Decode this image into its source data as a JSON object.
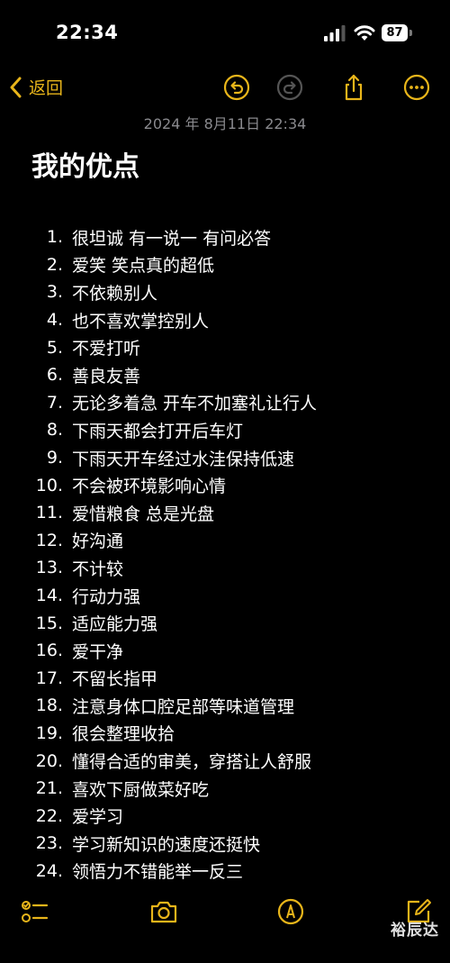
{
  "status_bar": {
    "time": "22:34",
    "battery": "87"
  },
  "nav": {
    "back_label": "返回"
  },
  "note": {
    "date": "2024 年 8月11日 22:34",
    "title": "我的优点",
    "items": [
      {
        "num": "1.",
        "text": "很坦诚 有一说一 有问必答"
      },
      {
        "num": "2.",
        "text": "爱笑 笑点真的超低"
      },
      {
        "num": "3.",
        "text": "不依赖别人"
      },
      {
        "num": "4.",
        "text": "也不喜欢掌控别人"
      },
      {
        "num": "5.",
        "text": "不爱打听"
      },
      {
        "num": "6.",
        "text": "善良友善"
      },
      {
        "num": "7.",
        "text": "无论多着急 开车不加塞礼让行人"
      },
      {
        "num": "8.",
        "text": "下雨天都会打开后车灯"
      },
      {
        "num": "9.",
        "text": "下雨天开车经过水洼保持低速"
      },
      {
        "num": "10.",
        "text": "不会被环境影响心情"
      },
      {
        "num": "11.",
        "text": "爱惜粮食 总是光盘"
      },
      {
        "num": "12.",
        "text": "好沟通"
      },
      {
        "num": "13.",
        "text": "不计较"
      },
      {
        "num": "14.",
        "text": "行动力强"
      },
      {
        "num": "15.",
        "text": "适应能力强"
      },
      {
        "num": "16.",
        "text": "爱干净"
      },
      {
        "num": "17.",
        "text": "不留长指甲"
      },
      {
        "num": "18.",
        "text": "注意身体口腔足部等味道管理"
      },
      {
        "num": "19.",
        "text": "很会整理收拾"
      },
      {
        "num": "20.",
        "text": "懂得合适的审美，穿搭让人舒服"
      },
      {
        "num": "21.",
        "text": "喜欢下厨做菜好吃"
      },
      {
        "num": "22.",
        "text": "爱学习"
      },
      {
        "num": "23.",
        "text": "学习新知识的速度还挺快"
      },
      {
        "num": "24.",
        "text": "领悟力不错能举一反三"
      }
    ]
  },
  "watermark": "裕辰达",
  "colors": {
    "accent": "#e8b51a",
    "background": "#000000",
    "secondary_text": "#8a8a8e"
  },
  "icons": {
    "nav": [
      "chevron-left-icon",
      "undo-icon",
      "redo-icon",
      "share-icon",
      "more-icon"
    ],
    "toolbar": [
      "checklist-icon",
      "camera-icon",
      "markup-pen-icon",
      "compose-icon"
    ]
  }
}
